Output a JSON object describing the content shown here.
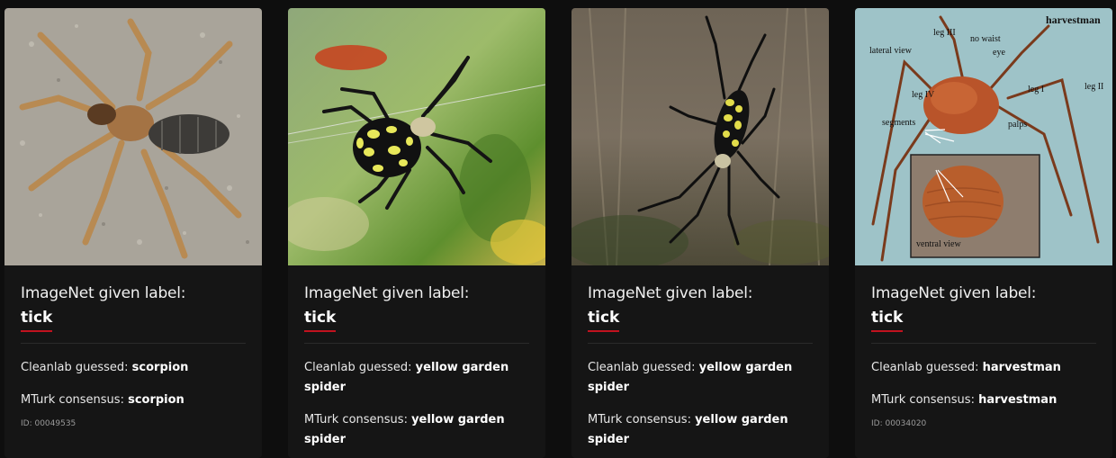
{
  "cards": [
    {
      "given_prefix": "ImageNet given label:",
      "given_label": "tick",
      "cleanlab_prefix": "Cleanlab guessed: ",
      "cleanlab_value": "scorpion",
      "mturk_prefix": "MTurk consensus: ",
      "mturk_value": "scorpion",
      "id": "ID: 00049535"
    },
    {
      "given_prefix": "ImageNet given label:",
      "given_label": "tick",
      "cleanlab_prefix": "Cleanlab guessed: ",
      "cleanlab_value": "yellow garden spider",
      "mturk_prefix": "MTurk consensus: ",
      "mturk_value": "yellow garden spider"
    },
    {
      "given_prefix": "ImageNet given label:",
      "given_label": "tick",
      "cleanlab_prefix": "Cleanlab guessed: ",
      "cleanlab_value": "yellow garden spider",
      "mturk_prefix": "MTurk consensus: ",
      "mturk_value": "yellow garden spider"
    },
    {
      "given_prefix": "ImageNet given label:",
      "given_label": "tick",
      "cleanlab_prefix": "Cleanlab guessed: ",
      "cleanlab_value": "harvestman",
      "mturk_prefix": "MTurk consensus: ",
      "mturk_value": "harvestman",
      "id": "ID: 00034020",
      "image_annotations": {
        "title": "harvestman",
        "lateral": "lateral view",
        "leg3": "leg III",
        "no_waist": "no waist",
        "eye": "eye",
        "leg4": "leg IV",
        "leg1": "leg I",
        "leg2": "leg II",
        "segments": "segments",
        "palps": "palps",
        "ventral": "ventral view"
      }
    }
  ],
  "colors": {
    "accent": "#c1121f",
    "background": "#0e0e0e",
    "card": "#151515"
  }
}
